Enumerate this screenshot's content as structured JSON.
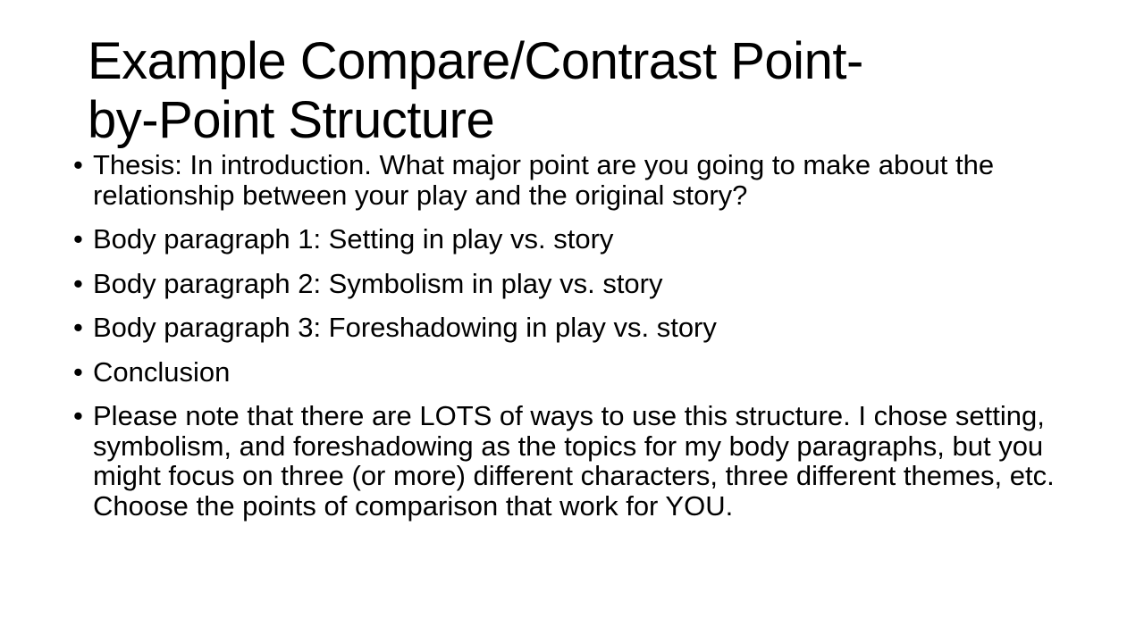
{
  "slide": {
    "background_color": "#ffffff",
    "text_color": "#000000",
    "title": "Example Compare/Contrast Point-by-Point Structure",
    "bullet_marker": "•",
    "bullets": [
      {
        "id": "thesis",
        "text": "Thesis: In introduction.  What major point are you going to make about the relationship between your play and the original story?"
      },
      {
        "id": "body-paragraph-1",
        "text": "Body paragraph 1: Setting in play vs. story"
      },
      {
        "id": "body-paragraph-2",
        "text": "Body paragraph 2: Symbolism in play vs. story"
      },
      {
        "id": "body-paragraph-3",
        "text": "Body paragraph 3: Foreshadowing in play vs. story"
      },
      {
        "id": "conclusion",
        "text": "Conclusion"
      },
      {
        "id": "note",
        "text": "Please note that there are LOTS of ways to use this structure.  I chose setting, symbolism, and foreshadowing as the topics for my body paragraphs, but you might focus on three (or more) different characters, three different themes, etc.  Choose the points of comparison that work for YOU."
      }
    ]
  }
}
